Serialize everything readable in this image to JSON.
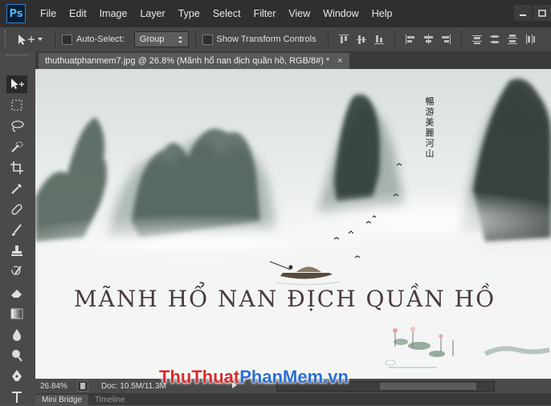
{
  "app": {
    "logo": "Ps"
  },
  "menu": [
    "File",
    "Edit",
    "Image",
    "Layer",
    "Type",
    "Select",
    "Filter",
    "View",
    "Window",
    "Help"
  ],
  "options": {
    "auto_select_label": "Auto-Select:",
    "auto_select_value": "Group",
    "show_transform_label": "Show Transform Controls"
  },
  "document": {
    "tab_title": "thuthuatphanmem7.jpg @ 26.8% (Mãnh hổ nan địch quần hồ, RGB/8#) *",
    "close_glyph": "×",
    "artwork": {
      "vertical_text": [
        "暢",
        "游",
        "美",
        "麗",
        "河",
        "山"
      ],
      "headline": "MÃNH HỔ NAN ĐỊCH QUẦN HỒ"
    }
  },
  "status": {
    "zoom": "26.84%",
    "doc": "Doc: 10.5M/11.3M"
  },
  "panels": [
    "Mini Bridge",
    "Timeline"
  ],
  "watermark": {
    "part1": "Thu",
    "part2": "Thuat",
    "part3": "PhanMem",
    "part4": ".vn"
  },
  "colors": {
    "accent": "#2f7fc9",
    "watermark_red": "#d92b2b",
    "watermark_blue": "#2a6fd6"
  }
}
